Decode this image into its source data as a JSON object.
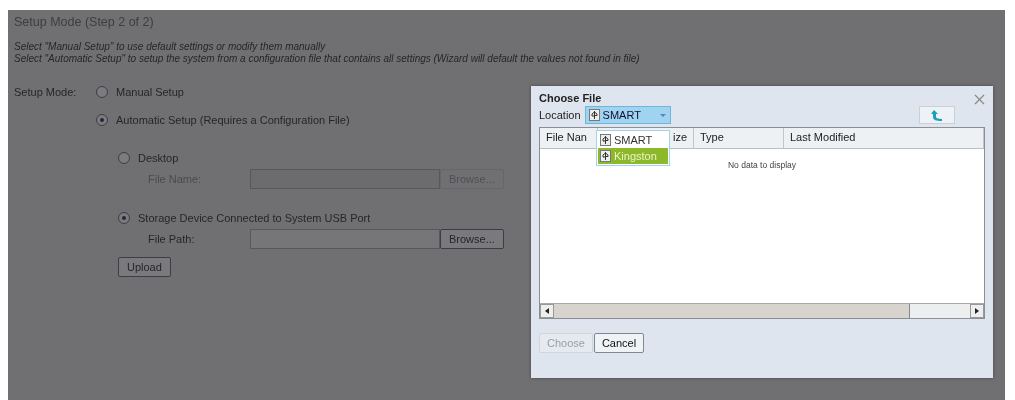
{
  "page": {
    "title": "Setup Mode (Step 2 of 2)",
    "instructions": [
      "Select \"Manual Setup\" to use default settings or modify them manually",
      "Select \"Automatic Setup\" to setup the system from a configuration file that contains all settings (Wizard will default the values not found in file)"
    ],
    "setup_mode_label": "Setup Mode:",
    "modes": [
      {
        "label": "Manual Setup",
        "selected": false
      },
      {
        "label": "Automatic Setup (Requires a Configuration File)",
        "selected": true
      }
    ],
    "sources": [
      {
        "label": "Desktop",
        "selected": false,
        "field_label": "File Name:",
        "disabled": true,
        "browse": "Browse..."
      },
      {
        "label": "Storage Device Connected to System USB Port",
        "selected": true,
        "field_label": "File Path:",
        "disabled": false,
        "browse": "Browse..."
      }
    ],
    "upload": "Upload"
  },
  "dialog": {
    "title": "Choose File",
    "location_label": "Location",
    "location_value": "SMART",
    "dropdown_options": [
      {
        "label": "SMART",
        "selected": false
      },
      {
        "label": "Kingston",
        "selected": true
      }
    ],
    "columns": [
      "File Nan",
      "ize",
      "Type",
      "Last Modified"
    ],
    "empty_text": "No data to display",
    "buttons": [
      {
        "label": "Choose",
        "disabled": true
      },
      {
        "label": "Cancel",
        "disabled": false
      }
    ]
  }
}
